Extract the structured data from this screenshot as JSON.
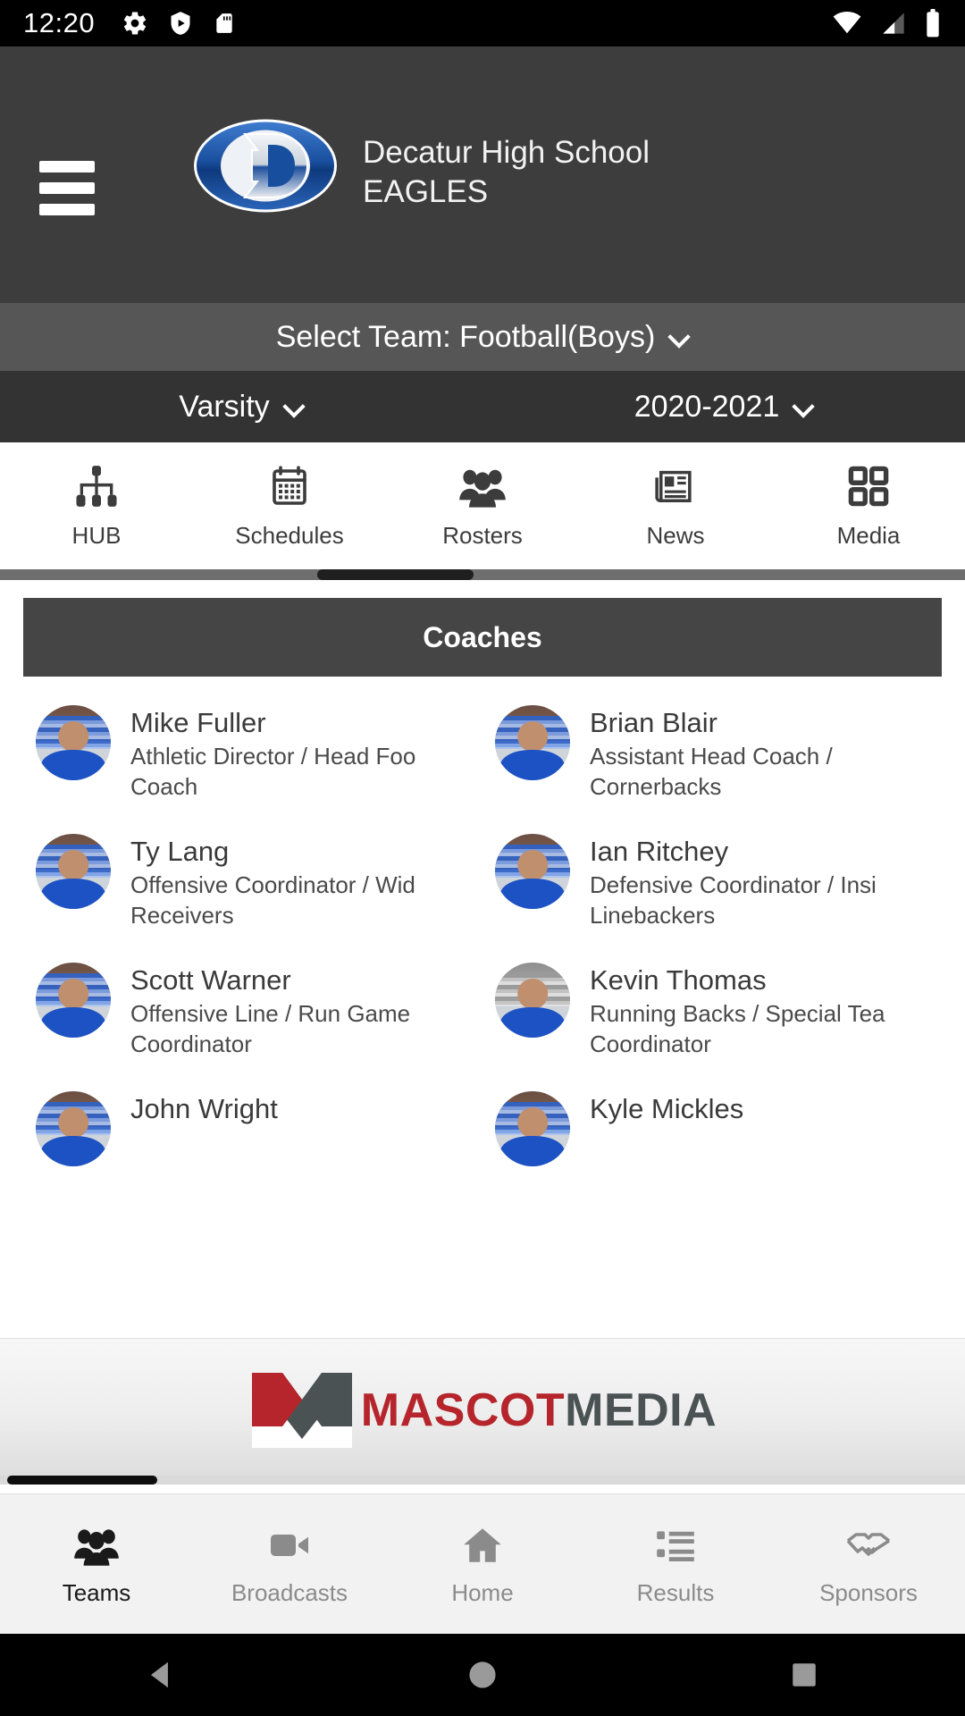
{
  "status_bar": {
    "time": "12:20",
    "left_icons": [
      "gear-icon",
      "play-shield-icon",
      "sd-card-icon"
    ],
    "right_icons": [
      "wifi-icon",
      "cell-signal-icon",
      "battery-icon"
    ]
  },
  "header": {
    "menu_icon": "hamburger-menu-icon",
    "logo": "decatur-d-logo",
    "school_name": "Decatur High School",
    "mascot": "EAGLES",
    "background_color": "#3d3d3d"
  },
  "team_selector": {
    "label": "Select Team:",
    "value": "Football(Boys)",
    "full_text": "Select Team: Football(Boys)",
    "chevron": "chevron-down-icon"
  },
  "level_selector": {
    "level": "Varsity",
    "season": "2020-2021",
    "chevron": "chevron-down-icon"
  },
  "tabs": [
    {
      "label": "HUB",
      "icon": "sitemap-icon"
    },
    {
      "label": "Schedules",
      "icon": "calendar-icon"
    },
    {
      "label": "Rosters",
      "icon": "people-group-icon"
    },
    {
      "label": "News",
      "icon": "newspaper-icon"
    },
    {
      "label": "Media",
      "icon": "grid-squares-icon"
    }
  ],
  "section": {
    "title": "Coaches"
  },
  "coaches": [
    {
      "name": "Mike Fuller",
      "title_line1": "Athletic Director / Head Foo",
      "title_line2": "Coach",
      "photo_style": "color"
    },
    {
      "name": "Brian Blair",
      "title_line1": "Assistant Head Coach /",
      "title_line2": "Cornerbacks",
      "photo_style": "color"
    },
    {
      "name": "Ty Lang",
      "title_line1": "Offensive Coordinator / Wid",
      "title_line2": "Receivers",
      "photo_style": "color"
    },
    {
      "name": "Ian Ritchey",
      "title_line1": "Defensive Coordinator / Insi",
      "title_line2": "Linebackers",
      "photo_style": "color"
    },
    {
      "name": "Scott Warner",
      "title_line1": "Offensive Line / Run Game",
      "title_line2": "Coordinator",
      "photo_style": "color"
    },
    {
      "name": "Kevin Thomas",
      "title_line1": "Running Backs / Special Tea",
      "title_line2": "Coordinator",
      "photo_style": "gray"
    },
    {
      "name": "John Wright",
      "title_line1": "",
      "title_line2": "",
      "photo_style": "color"
    },
    {
      "name": "Kyle Mickles",
      "title_line1": "",
      "title_line2": "",
      "photo_style": "color"
    }
  ],
  "sponsor_banner": {
    "mark": "mascot-m-logo",
    "word_primary": "MASCOT",
    "word_secondary": "MEDIA",
    "primary_color": "#b5252b",
    "secondary_color": "#4a5254"
  },
  "bottom_nav": [
    {
      "label": "Teams",
      "icon": "people-group-icon",
      "active": true
    },
    {
      "label": "Broadcasts",
      "icon": "video-camera-icon",
      "active": false
    },
    {
      "label": "Home",
      "icon": "home-icon",
      "active": false
    },
    {
      "label": "Results",
      "icon": "list-icon",
      "active": false
    },
    {
      "label": "Sponsors",
      "icon": "handshake-icon",
      "active": false
    }
  ],
  "android_nav": {
    "back": "back-triangle-icon",
    "home": "home-circle-icon",
    "recents": "recents-square-icon"
  }
}
